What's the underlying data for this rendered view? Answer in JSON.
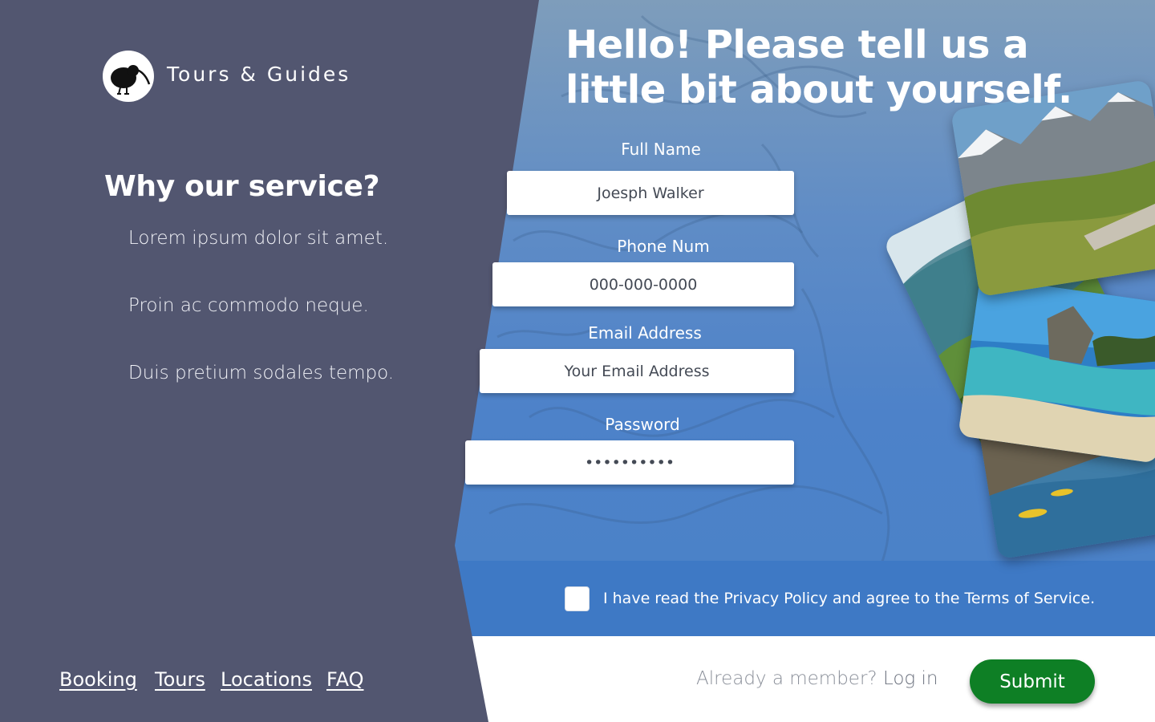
{
  "brand": {
    "name": "Tours & Guides",
    "logo_icon": "kiwi-bird-icon"
  },
  "sidebar": {
    "title": "Why our service?",
    "items": [
      "Lorem ipsum dolor sit amet.",
      "Proin ac commodo neque.",
      "Duis pretium sodales tempo."
    ]
  },
  "footer_nav": {
    "links": [
      "Booking",
      "Tours",
      "Locations",
      "FAQ"
    ]
  },
  "form": {
    "headline": "Hello! Please tell us a little bit about yourself.",
    "fields": [
      {
        "label": "Full Name",
        "value": "Joesph Walker",
        "placeholder": "Joesph Walker"
      },
      {
        "label": "Phone Num",
        "value": "",
        "placeholder": "000-000-0000"
      },
      {
        "label": "Email Address",
        "value": "",
        "placeholder": "Your Email Address"
      },
      {
        "label": "Password",
        "value": "••••••••••",
        "placeholder": ""
      }
    ],
    "terms_text": "I have read the Privacy Policy and agree to the Terms of Service.",
    "terms_checked": false,
    "member_prompt": "Already a member?",
    "login_label": "Log in",
    "submit_label": "Submit"
  },
  "colors": {
    "sidebar_bg": "#525670",
    "hero_blue": "#4a82c8",
    "terms_strip": "#3e79c5",
    "submit_green": "#0e7f25"
  },
  "photos": [
    {
      "icon": "mountain-landscape-photo"
    },
    {
      "icon": "forest-valley-photo"
    },
    {
      "icon": "beach-cove-photo"
    },
    {
      "icon": "river-kayak-photo"
    }
  ]
}
